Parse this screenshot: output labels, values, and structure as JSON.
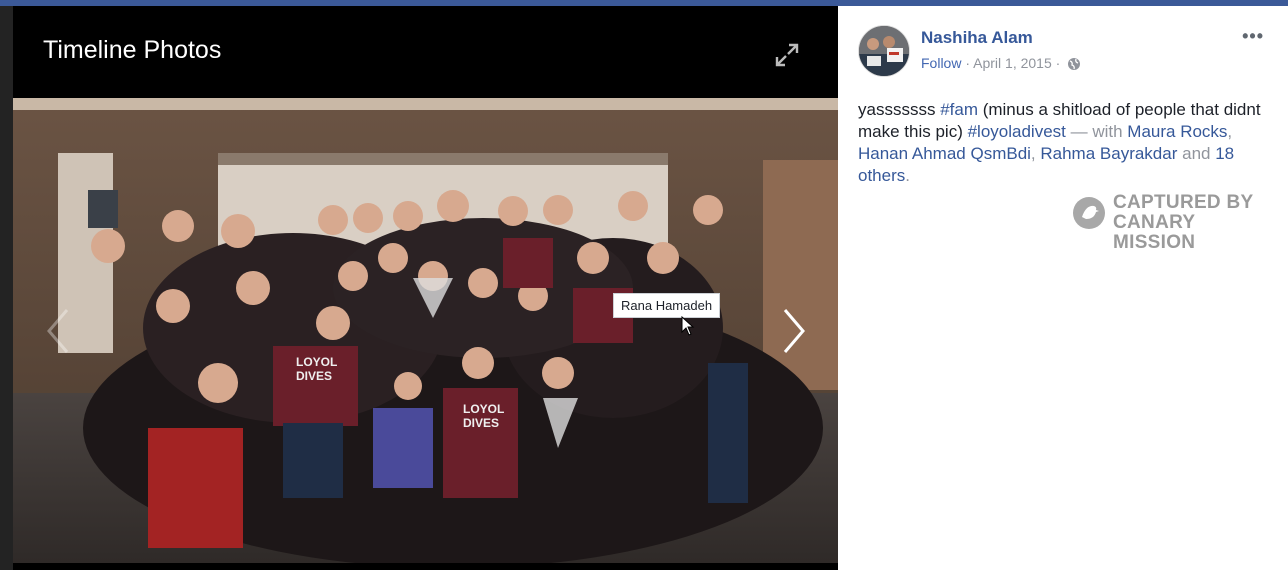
{
  "viewer": {
    "title": "Timeline Photos",
    "photo_tag": "Rana Hamadeh",
    "photo_shirt_text": [
      "LOYOL",
      "DIVES",
      "LOYOL",
      "DIVES"
    ]
  },
  "post": {
    "author": "Nashiha Alam",
    "follow_label": "Follow",
    "dot_1": " · ",
    "date": "April 1, 2015",
    "dot_2": " · ",
    "more_label": "•••",
    "caption": {
      "t1": "yasssssss ",
      "hashtag1": "#fam",
      "t2": " (minus a shitload of people that didnt make this pic) ",
      "hashtag2": "#loyoladivest",
      "t3": " — with ",
      "tag1": "Maura Rocks",
      "t4": ", ",
      "tag2": "Hanan Ahmad QsmBdi",
      "t5": ", ",
      "tag3": "Rahma Bayrakdar",
      "t6": " and ",
      "others": "18 others",
      "t7": "."
    },
    "watermark": {
      "line1": "CAPTURED BY",
      "line2": "CANARY MISSION"
    }
  },
  "colors": {
    "link": "#365899",
    "muted": "#90949c",
    "accent": "#4267b2"
  }
}
